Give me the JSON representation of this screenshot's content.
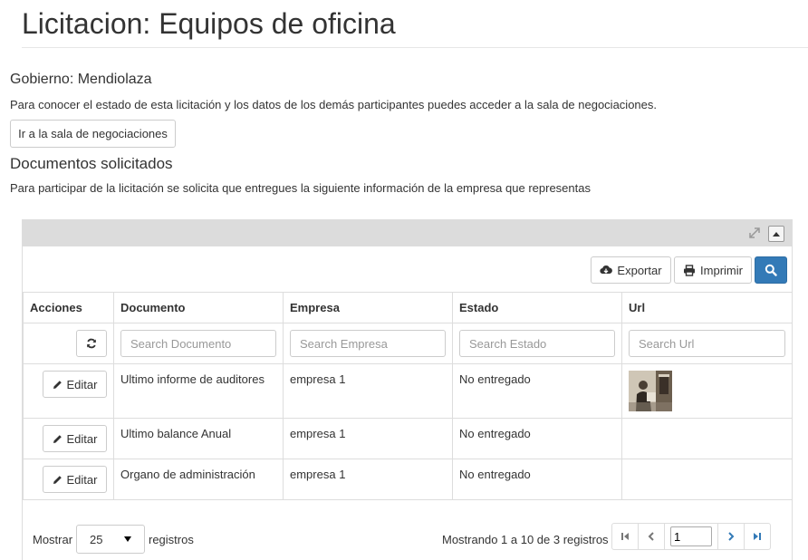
{
  "header": {
    "title": "Licitacion: Equipos de oficina"
  },
  "government": "Gobierno: Mendiolaza",
  "intro_text": "Para conocer el estado de esta licitación y los datos de los demás participantes puedes acceder a la sala de negociaciones.",
  "room_button_label": "Ir a la sala de negociaciones",
  "documents": {
    "heading": "Documentos solicitados",
    "description": "Para participar de la licitación se solicita que entregues la siguiente información de la empresa que representas"
  },
  "toolbar": {
    "export_label": "Exportar",
    "print_label": "Imprimir",
    "icons": {
      "export": "cloud-download-icon",
      "print": "print-icon",
      "search": "search-icon",
      "expand": "expand-icon",
      "collapse": "caret-up-icon"
    }
  },
  "table": {
    "columns": [
      "Acciones",
      "Documento",
      "Empresa",
      "Estado",
      "Url"
    ],
    "placeholders": {
      "documento": "Search Documento",
      "empresa": "Search Empresa",
      "estado": "Search Estado",
      "url": "Search Url"
    },
    "edit_label": "Editar",
    "rows": [
      {
        "documento": "Ultimo informe de auditores",
        "empresa": "empresa 1",
        "estado": "No entregado",
        "url": "image-thumbnail"
      },
      {
        "documento": "Ultimo balance Anual",
        "empresa": "empresa 1",
        "estado": "No entregado",
        "url": ""
      },
      {
        "documento": "Organo de administración",
        "empresa": "empresa 1",
        "estado": "No entregado",
        "url": ""
      }
    ]
  },
  "footer": {
    "show_label": "Mostrar",
    "page_size": "25",
    "records_label": "registros",
    "info": "Mostrando 1 a 10 de 3 registros",
    "page_value": "1"
  },
  "colors": {
    "primary": "#337ab7",
    "panel_header": "#dcdcdc",
    "link": "#337ab7"
  }
}
